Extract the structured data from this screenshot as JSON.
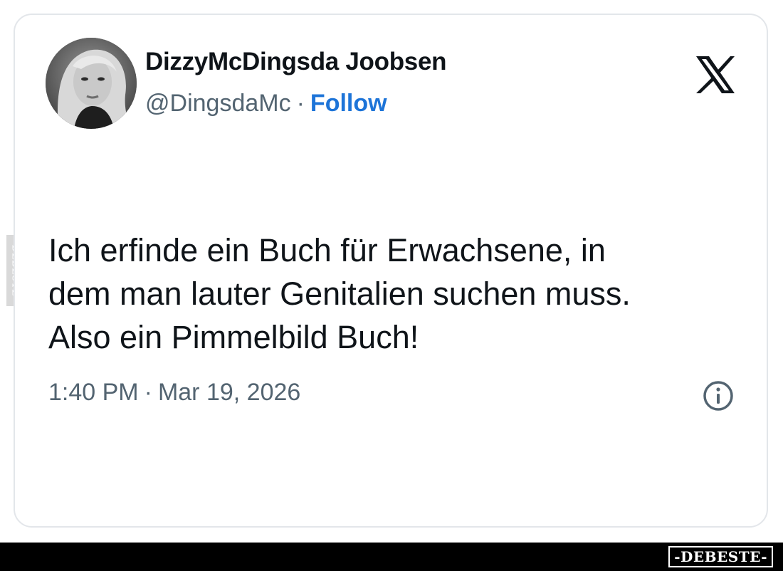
{
  "tweet": {
    "author": {
      "display_name": "DizzyMcDingsda Joobsen",
      "handle": "@DingsdaMc",
      "separator": "·",
      "follow_label": "Follow",
      "avatar_icon": "profile-photo"
    },
    "platform_icon": "x-logo-icon",
    "text_lines": [
      "Ich erfinde ein Buch für Erwachsene, in",
      "dem man lauter Genitalien suchen muss.",
      "Also ein Pimmelbild Buch!"
    ],
    "time": "1:40 PM",
    "time_separator": "·",
    "date": "Mar 19, 2026",
    "info_icon": "info-icon"
  },
  "watermark": {
    "side_text": "DEBESTE",
    "bottom_text": "-DEBESTE-"
  },
  "colors": {
    "text_primary": "#0f1419",
    "text_secondary": "#536471",
    "follow_link": "#1d74d8",
    "card_border": "#e3e6ea",
    "bottom_bar": "#000000"
  }
}
